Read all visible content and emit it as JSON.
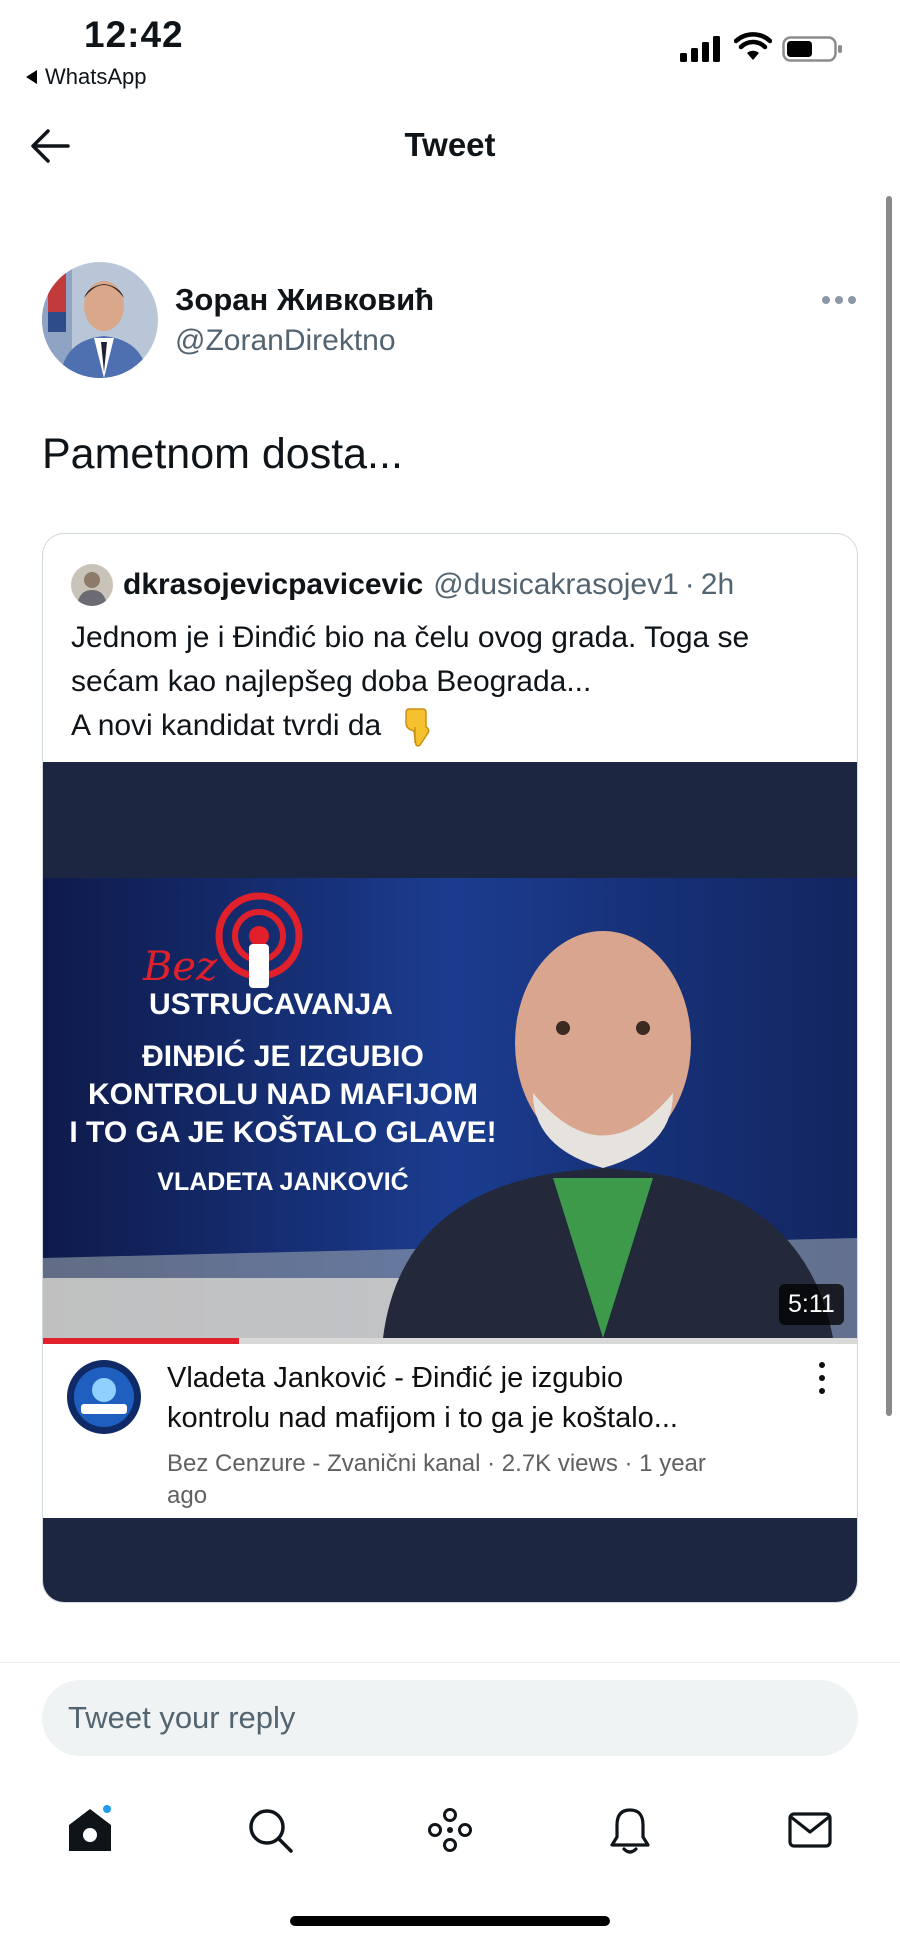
{
  "status_bar": {
    "time": "12:42",
    "back_app": "WhatsApp",
    "icons": [
      "signal-icon",
      "wifi-icon",
      "battery-icon"
    ]
  },
  "header": {
    "title": "Tweet",
    "back_icon": "back-arrow-icon"
  },
  "tweet": {
    "author_name": "Зоран Живковић",
    "author_handle": "@ZoranDirektno",
    "text": "Pametnom dosta...",
    "more_icon": "more-horizontal-icon"
  },
  "quoted_tweet": {
    "name": "dkrasojevicpavicevic",
    "handle": "@dusicakrasojev1",
    "separator": "·",
    "time": "2h",
    "lines": [
      "Jednom je i Đinđić bio na čelu ovog grada. Toga se",
      "sećam kao najlepšeg doba Beograda...",
      "A novi kandidat tvrdi da"
    ],
    "emoji": "backhand-index-pointing-down"
  },
  "video": {
    "thumbnail_texts": {
      "brand_script": "Bez",
      "brand": "USTRUCAVANJA",
      "headline_lines": [
        "ĐINĐIĆ JE IZGUBIO",
        "KONTROLU NAD MAFIJOM",
        "I TO GA JE KOŠTALO GLAVE!"
      ],
      "speaker": "VLADETA JANKOVIĆ"
    },
    "duration": "5:11",
    "progress_fraction": 0.24,
    "title_line1": "Vladeta Janković - Đinđić je izgubio",
    "title_line2": "kontrolu nad mafijom i to ga je koštalo...",
    "meta_line1": "Bez Cenzure - Zvanični kanal · 2.7K views · 1 year",
    "meta_line2": "ago"
  },
  "reply": {
    "placeholder": "Tweet your reply"
  },
  "bottom_nav": {
    "items": [
      "home-icon",
      "search-icon",
      "spaces-icon",
      "notifications-icon",
      "messages-icon"
    ],
    "notification_dot_color": "#1d9bf0"
  },
  "colors": {
    "text": "#0f1419",
    "secondary": "#536471",
    "accent": "#1d9bf0",
    "video_bg": "#1c2640",
    "progress_red": "#e0202b"
  }
}
